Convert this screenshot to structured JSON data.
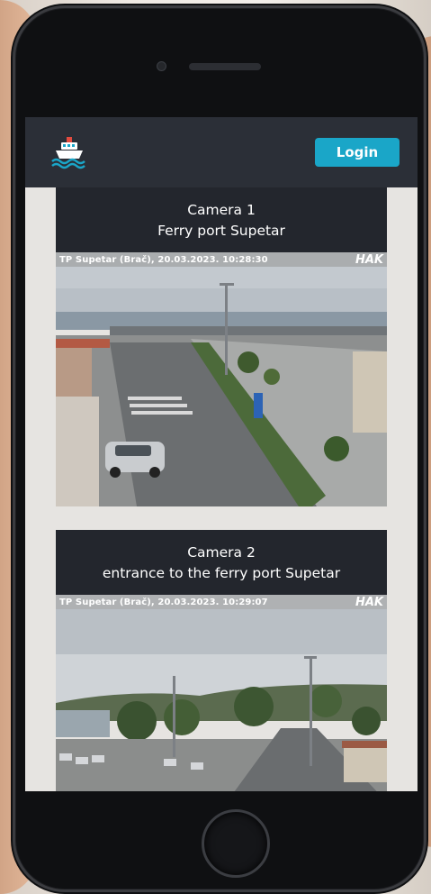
{
  "header": {
    "login_label": "Login",
    "logo_icon": "ferry-ship-icon",
    "accent_color": "#1aa6c8"
  },
  "cameras": [
    {
      "title_line1": "Camera 1",
      "title_line2": "Ferry port Supetar",
      "stamp": "TP Supetar (Brač), 20.03.2023. 10:28:30",
      "brand": "HAK"
    },
    {
      "title_line1": "Camera 2",
      "title_line2": "entrance to the ferry port Supetar",
      "stamp": "TP Supetar (Brač), 20.03.2023. 10:29:07",
      "brand": "HAK"
    }
  ]
}
